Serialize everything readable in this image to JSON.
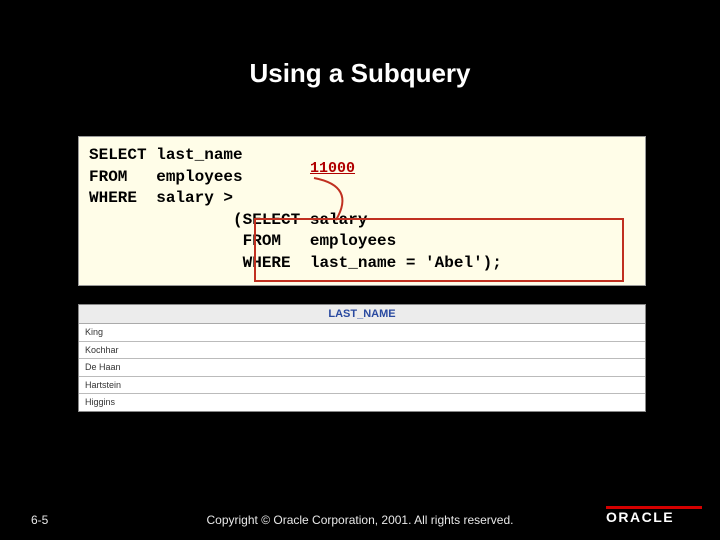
{
  "title": "Using a Subquery",
  "code": "SELECT last_name\nFROM   employees\nWHERE  salary >\n               (SELECT salary\n                FROM   employees\n                WHERE  last_name = 'Abel');",
  "annotation_value": "11000",
  "result": {
    "header": "LAST_NAME",
    "rows": [
      "King",
      "Kochhar",
      "De Haan",
      "Hartstein",
      "Higgins"
    ]
  },
  "footer": {
    "page": "6-5",
    "copyright": "Copyright © Oracle Corporation, 2001. All rights reserved.",
    "logo_text": "ORACLE"
  }
}
